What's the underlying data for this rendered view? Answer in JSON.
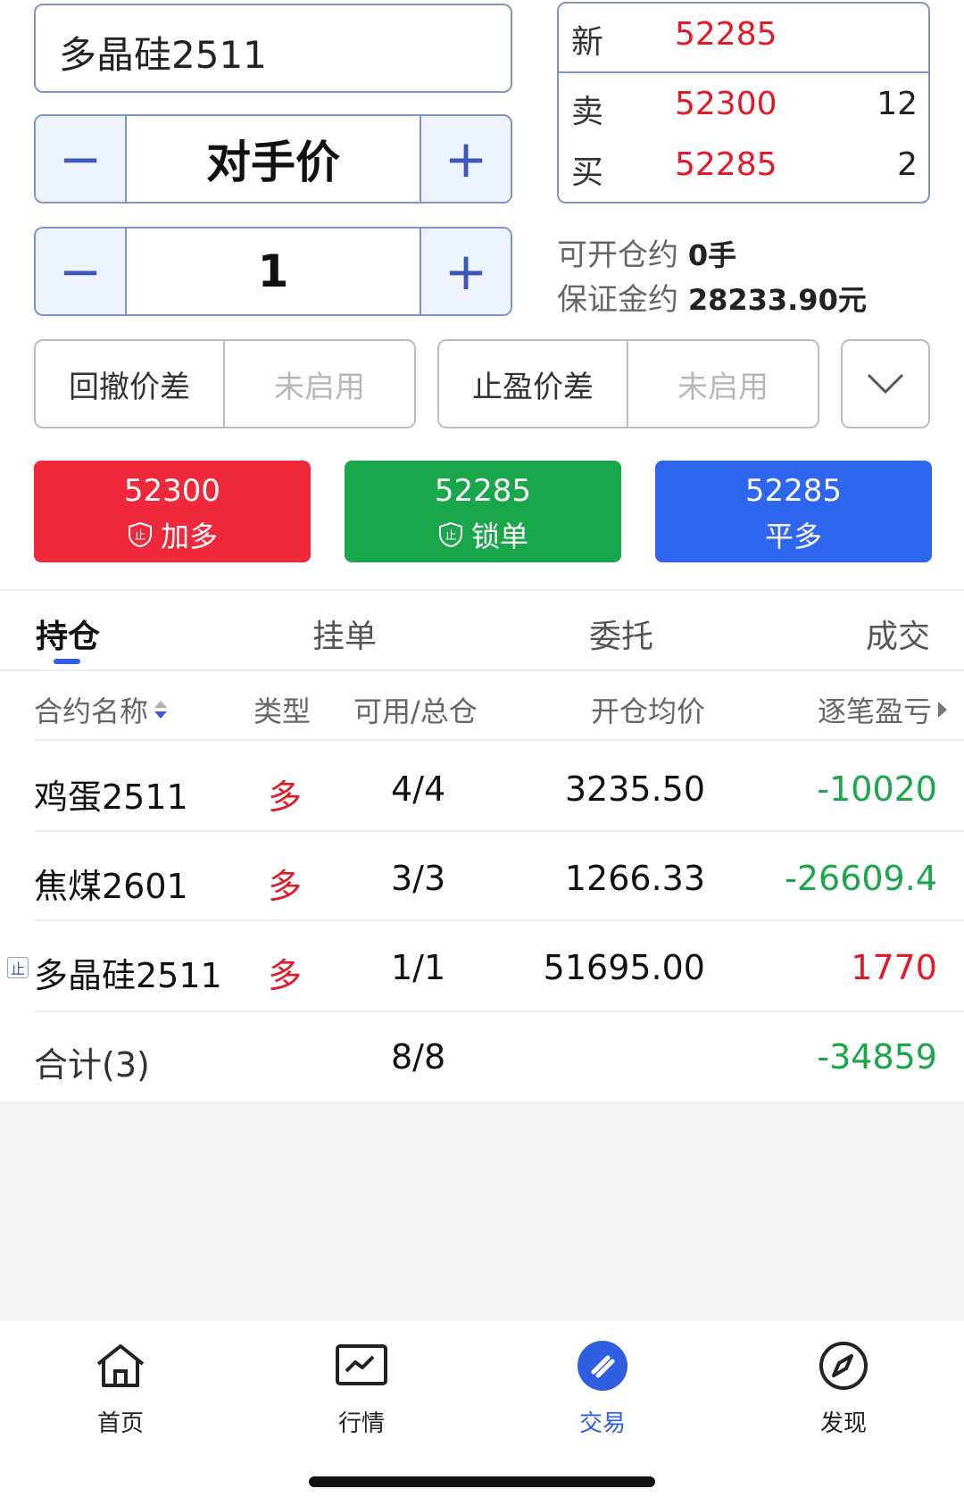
{
  "order": {
    "contract": "多晶硅2511",
    "price_mode": "对手价",
    "quantity": "1",
    "minus": "−",
    "plus": "+"
  },
  "quote": {
    "last_label": "新",
    "last_price": "52285",
    "ask_label": "卖",
    "ask_price": "52300",
    "ask_volume": "12",
    "bid_label": "买",
    "bid_price": "52285",
    "bid_volume": "2"
  },
  "info": {
    "open_label": "可开仓约",
    "open_value": "0手",
    "margin_label": "保证金约",
    "margin_value": "28233.90元"
  },
  "spreads": {
    "pullback_label": "回撤价差",
    "pullback_value": "未启用",
    "takeprofit_label": "止盈价差",
    "takeprofit_value": "未启用"
  },
  "actions": [
    {
      "price": "52300",
      "label": "加多",
      "color": "#f0283b"
    },
    {
      "price": "52285",
      "label": "锁单",
      "color": "#1aa64a"
    },
    {
      "price": "52285",
      "label": "平多",
      "color": "#2f66f0"
    }
  ],
  "tabs": [
    "持仓",
    "挂单",
    "委托",
    "成交"
  ],
  "table": {
    "headers": [
      "合约名称",
      "类型",
      "可用/总仓",
      "开仓均价",
      "逐笔盈亏"
    ],
    "rows": [
      {
        "name": "鸡蛋2511",
        "type": "多",
        "qty": "4/4",
        "avg": "3235.50",
        "pnl": "-10020"
      },
      {
        "name": "焦煤2601",
        "type": "多",
        "qty": "3/3",
        "avg": "1266.33",
        "pnl": "-26609.4"
      },
      {
        "name": "多晶硅2511",
        "type": "多",
        "qty": "1/1",
        "avg": "51695.00",
        "pnl": "1770",
        "badge": "止"
      }
    ],
    "total_label": "合计(3)",
    "total_qty": "8/8",
    "total_pnl": "-34859"
  },
  "nav": [
    {
      "label": "首页",
      "icon": "home-icon"
    },
    {
      "label": "行情",
      "icon": "chart-icon"
    },
    {
      "label": "交易",
      "icon": "trade-icon"
    },
    {
      "label": "发现",
      "icon": "compass-icon"
    }
  ],
  "colors": {
    "accent": "#2f5fe0",
    "up": "#e21a28",
    "down": "#1aa64a"
  }
}
